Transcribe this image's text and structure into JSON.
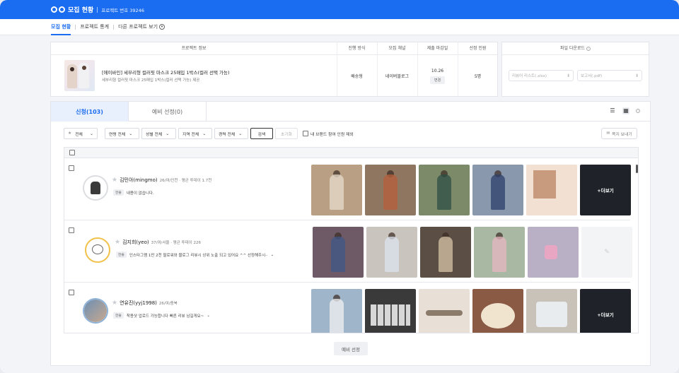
{
  "header": {
    "title": "모집 현황",
    "project_no": "프로젝트 번호 39246",
    "brand_color": "#1a6cf0"
  },
  "nav": {
    "tabs": [
      "모집 현황",
      "프로젝트 통계",
      "다른 프로젝트 보기"
    ],
    "active": "모집 현황"
  },
  "project_info": {
    "headers": {
      "info": "프로젝트 정보",
      "method": "진행 방식",
      "channel": "모집 채널",
      "deadline": "제출 마감일",
      "selected": "선정 인원"
    },
    "product_name": "[에이바인] 세부리형 컬러핏 마스크 25매입 1박스(컬러 선택 가능)",
    "product_desc": "세부리형 컬러핏 마스크 25매입 1박스(컬러 선택 가능) 제공",
    "method": "배송형",
    "channel": "네이버블로그",
    "deadline": "10.26",
    "deadline_change": "변경",
    "selected_count": "5명"
  },
  "file_download": {
    "title": "파일 다운로드",
    "reviewer_list": "리뷰어 리스트(.xlsx)",
    "report": "보고서(.pdf)"
  },
  "selection_tabs": {
    "applied": "신청(103)",
    "reserve": "예비 선정(0)"
  },
  "filters": {
    "all": "전체",
    "age": "연령 전체",
    "gender": "성별 전체",
    "region": "지역 전체",
    "career": "경력 전체",
    "search": "검색",
    "reset": "초기화",
    "exclude_label": "내 브랜드 참여 인원 제외",
    "message": "쪽지 보내기"
  },
  "applicants": [
    {
      "name": "김민아(mingmo)",
      "meta": "26/여/인천 · 평균 투데이 1.7천",
      "tag": "한줄",
      "intro": "내용이 없습니다.",
      "more": "+더보기",
      "has_expand": false,
      "photos": [
        "#b9a085",
        "#a2876f",
        "#7d8a6a",
        "#6e7f99",
        "#e9c9b8",
        "#1f2329"
      ]
    },
    {
      "name": "김지희(yeo)",
      "meta": "37/여/서울 · 평균 투데이 226",
      "tag": "한줄",
      "intro": "인스타그램 1만 2천 팔로워와 블로그 리뷰시 상위 노출 되고 있어요 ^^ 선정해주시··",
      "more": "",
      "has_expand": true,
      "photos": [
        "#6d5a66",
        "#c9c4bd",
        "#5b4e45",
        "#c9b3a5",
        "#b9b0c6",
        "#f3f4f6"
      ]
    },
    {
      "name": "연유진(yyj1998)",
      "meta": "26/여/충북",
      "tag": "한줄",
      "intro": "착용샷 업로드 가능합니다 빠른 리뷰 남길게요~",
      "more": "+더보기",
      "has_expand": true,
      "photos": [
        "#9fb5c9",
        "#3a3a3a",
        "#e8e0d6",
        "#b76b4f",
        "#c8c2b8",
        "#2d2f36"
      ]
    }
  ],
  "reserve_button": "예비 선정"
}
